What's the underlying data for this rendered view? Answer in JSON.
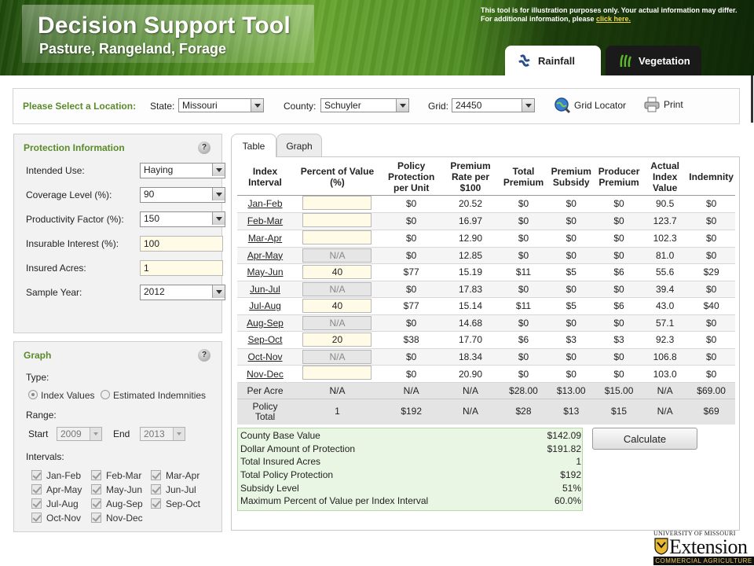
{
  "header": {
    "title": "Decision Support Tool",
    "subtitle": "Pasture, Rangeland, Forage",
    "disclaimer_line1": "This tool is for illustration purposes only. Your actual information may differ.",
    "disclaimer_line2": "For additional information, please",
    "disclaimer_link": "click here.",
    "tabs": [
      {
        "label": "Rainfall",
        "icon": "rainfall-icon",
        "active": true
      },
      {
        "label": "Vegetation",
        "icon": "vegetation-icon",
        "active": false
      }
    ],
    "colors": {
      "brand_green": "#5a8a2a",
      "accent_link": "#f2d64a"
    }
  },
  "location": {
    "prompt": "Please Select a Location:",
    "state_label": "State:",
    "state_value": "Missouri",
    "county_label": "County:",
    "county_value": "Schuyler",
    "grid_label": "Grid:",
    "grid_value": "24450",
    "grid_locator": "Grid Locator",
    "print": "Print"
  },
  "protection": {
    "title": "Protection Information",
    "help": "?",
    "intended_use_label": "Intended Use:",
    "intended_use_value": "Haying",
    "coverage_label": "Coverage Level (%):",
    "coverage_value": "90",
    "productivity_label": "Productivity Factor (%):",
    "productivity_value": "150",
    "insurable_label": "Insurable Interest (%):",
    "insurable_value": "100",
    "acres_label": "Insured Acres:",
    "acres_value": "1",
    "year_label": "Sample Year:",
    "year_value": "2012"
  },
  "graph": {
    "title": "Graph",
    "help": "?",
    "type_label": "Type:",
    "type_options": [
      "Index Values",
      "Estimated Indemnities"
    ],
    "range_label": "Range:",
    "start_label": "Start",
    "start_value": "2009",
    "end_label": "End",
    "end_value": "2013",
    "intervals_label": "Intervals:",
    "intervals": [
      "Jan-Feb",
      "Feb-Mar",
      "Mar-Apr",
      "Apr-May",
      "May-Jun",
      "Jun-Jul",
      "Jul-Aug",
      "Aug-Sep",
      "Sep-Oct",
      "Oct-Nov",
      "Nov-Dec"
    ]
  },
  "tabs": {
    "table": "Table",
    "graph": "Graph"
  },
  "table": {
    "headers": {
      "interval": [
        "Index",
        "Interval"
      ],
      "percent": [
        "Percent of Value (%)"
      ],
      "policy": [
        "Policy",
        "Protection",
        "per Unit"
      ],
      "rate": [
        "Premium",
        "Rate per",
        "$100"
      ],
      "total": [
        "Total",
        "Premium"
      ],
      "subsidy": [
        "Premium",
        "Subsidy"
      ],
      "producer": [
        "Producer",
        "Premium"
      ],
      "actual": [
        "Actual",
        "Index",
        "Value"
      ],
      "indemnity": [
        "Indemnity"
      ]
    },
    "rows": [
      {
        "interval": "Jan-Feb",
        "pv": "",
        "na": false,
        "policy": "$0",
        "rate": "20.52",
        "total": "$0",
        "subsidy": "$0",
        "producer": "$0",
        "actual": "90.5",
        "indemnity": "$0"
      },
      {
        "interval": "Feb-Mar",
        "pv": "",
        "na": false,
        "policy": "$0",
        "rate": "16.97",
        "total": "$0",
        "subsidy": "$0",
        "producer": "$0",
        "actual": "123.7",
        "indemnity": "$0"
      },
      {
        "interval": "Mar-Apr",
        "pv": "",
        "na": false,
        "policy": "$0",
        "rate": "12.90",
        "total": "$0",
        "subsidy": "$0",
        "producer": "$0",
        "actual": "102.3",
        "indemnity": "$0"
      },
      {
        "interval": "Apr-May",
        "pv": "N/A",
        "na": true,
        "policy": "$0",
        "rate": "12.85",
        "total": "$0",
        "subsidy": "$0",
        "producer": "$0",
        "actual": "81.0",
        "indemnity": "$0"
      },
      {
        "interval": "May-Jun",
        "pv": "40",
        "na": false,
        "policy": "$77",
        "rate": "15.19",
        "total": "$11",
        "subsidy": "$5",
        "producer": "$6",
        "actual": "55.6",
        "indemnity": "$29"
      },
      {
        "interval": "Jun-Jul",
        "pv": "N/A",
        "na": true,
        "policy": "$0",
        "rate": "17.83",
        "total": "$0",
        "subsidy": "$0",
        "producer": "$0",
        "actual": "39.4",
        "indemnity": "$0"
      },
      {
        "interval": "Jul-Aug",
        "pv": "40",
        "na": false,
        "policy": "$77",
        "rate": "15.14",
        "total": "$11",
        "subsidy": "$5",
        "producer": "$6",
        "actual": "43.0",
        "indemnity": "$40"
      },
      {
        "interval": "Aug-Sep",
        "pv": "N/A",
        "na": true,
        "policy": "$0",
        "rate": "14.68",
        "total": "$0",
        "subsidy": "$0",
        "producer": "$0",
        "actual": "57.1",
        "indemnity": "$0"
      },
      {
        "interval": "Sep-Oct",
        "pv": "20",
        "na": false,
        "policy": "$38",
        "rate": "17.70",
        "total": "$6",
        "subsidy": "$3",
        "producer": "$3",
        "actual": "92.3",
        "indemnity": "$0"
      },
      {
        "interval": "Oct-Nov",
        "pv": "N/A",
        "na": true,
        "policy": "$0",
        "rate": "18.34",
        "total": "$0",
        "subsidy": "$0",
        "producer": "$0",
        "actual": "106.8",
        "indemnity": "$0"
      },
      {
        "interval": "Nov-Dec",
        "pv": "",
        "na": false,
        "policy": "$0",
        "rate": "20.90",
        "total": "$0",
        "subsidy": "$0",
        "producer": "$0",
        "actual": "103.0",
        "indemnity": "$0"
      }
    ],
    "per_acre": {
      "label": "Per Acre",
      "pv": "N/A",
      "policy": "N/A",
      "rate": "N/A",
      "total": "$28.00",
      "subsidy": "$13.00",
      "producer": "$15.00",
      "actual": "N/A",
      "indemnity": "$69.00"
    },
    "policy_total": {
      "label": [
        "Policy",
        "Total"
      ],
      "pv": "1",
      "policy": "$192",
      "rate": "N/A",
      "total": "$28",
      "subsidy": "$13",
      "producer": "$15",
      "actual": "N/A",
      "indemnity": "$69"
    }
  },
  "summary": [
    {
      "label": "County Base Value",
      "value": "$142.09"
    },
    {
      "label": "Dollar Amount of Protection",
      "value": "$191.82"
    },
    {
      "label": "Total Insured Acres",
      "value": "1"
    },
    {
      "label": "Total Policy Protection",
      "value": "$192"
    },
    {
      "label": "Subsidy Level",
      "value": "51%"
    },
    {
      "label": "Maximum Percent of Value per Index Interval",
      "value": "60.0%"
    }
  ],
  "calculate": "Calculate",
  "footer": {
    "university": "UNIVERSITY OF MISSOURI",
    "extension": "Extension",
    "program": "COMMERCIAL AGRICULTURE"
  }
}
